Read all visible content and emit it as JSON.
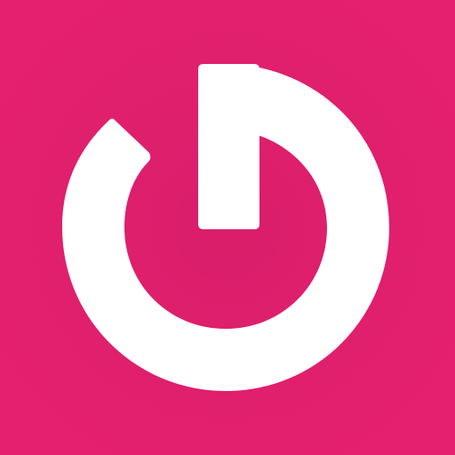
{
  "app_icon": {
    "icon": "power-symbol-icon",
    "background_color": "#E5206F",
    "background_color_center": "#D91E6A",
    "foreground_color": "#FFFFFF"
  }
}
